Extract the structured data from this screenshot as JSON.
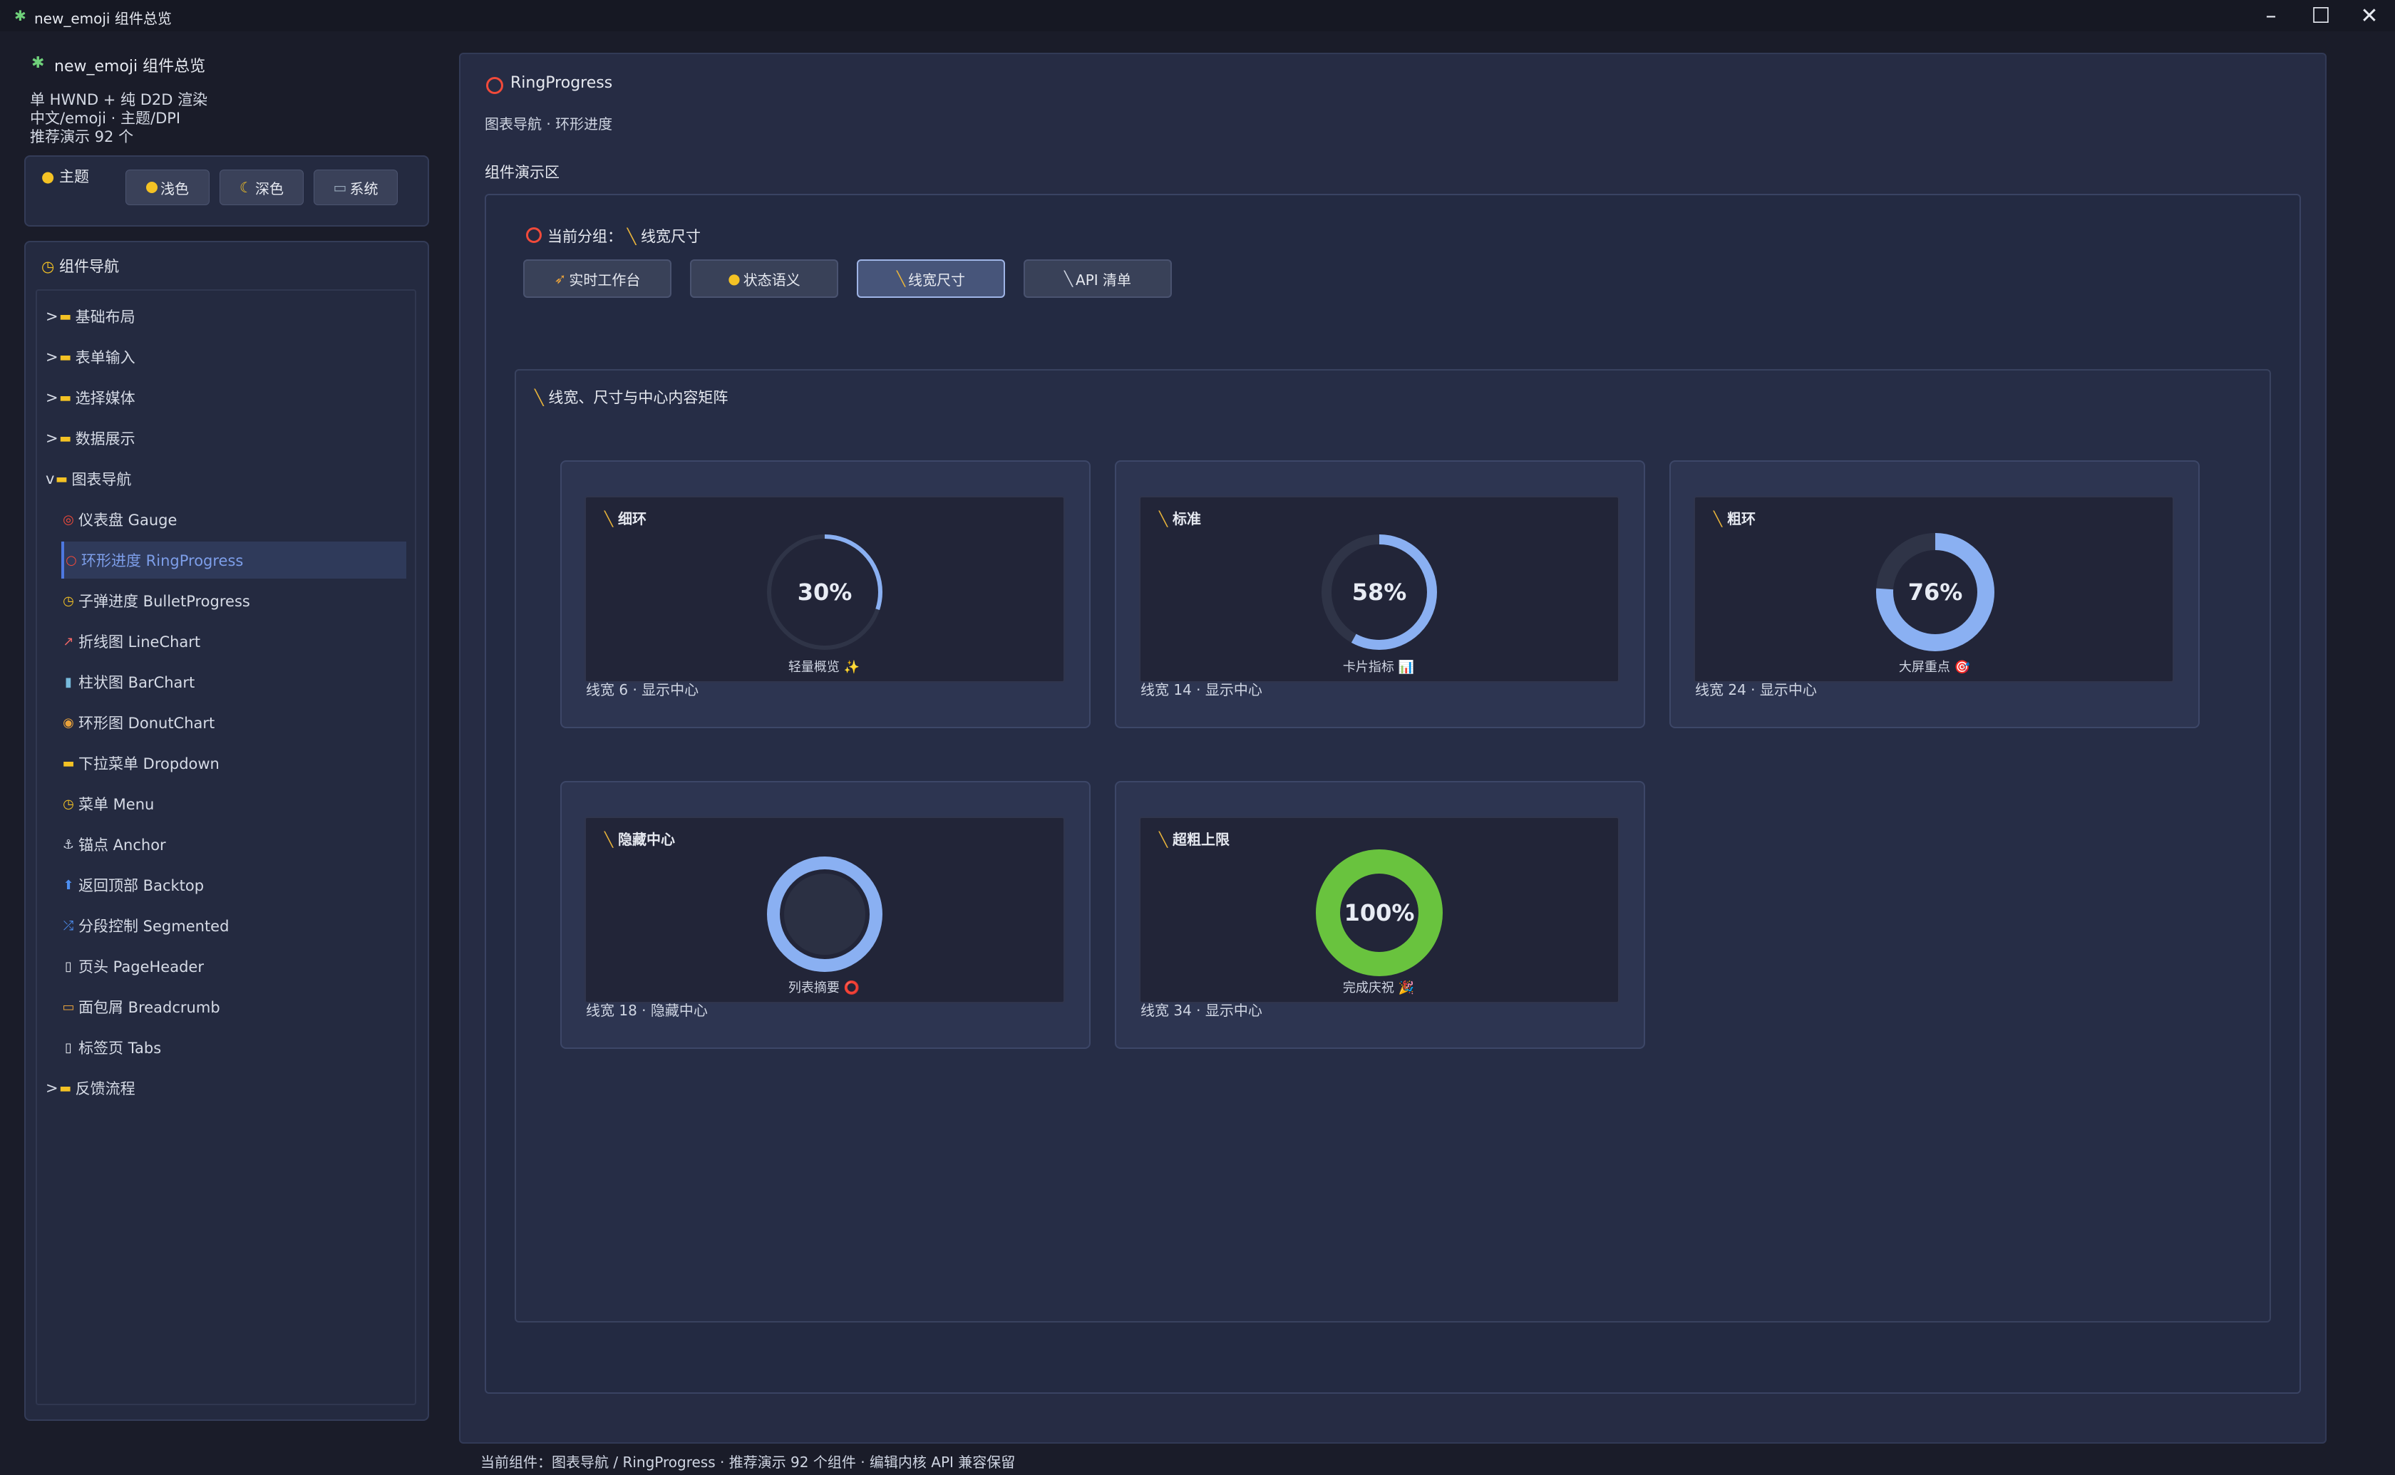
{
  "window": {
    "title": "new_emoji 组件总览",
    "controls": [
      "minimize",
      "maximize",
      "close"
    ]
  },
  "sidebar": {
    "title": "new_emoji 组件总览",
    "info": [
      "单 HWND + 纯 D2D 渲染",
      "中文/emoji · 主题/DPI",
      "推荐演示 92 个"
    ],
    "theme": {
      "label": "主题",
      "options": [
        "浅色",
        "深色",
        "系统"
      ]
    },
    "nav": {
      "label": "组件导航",
      "items": [
        {
          "prefix": ">",
          "label": "基础布局"
        },
        {
          "prefix": ">",
          "label": "表单输入"
        },
        {
          "prefix": ">",
          "label": "选择媒体"
        },
        {
          "prefix": ">",
          "label": "数据展示"
        },
        {
          "prefix": "v",
          "label": "图表导航"
        },
        {
          "label": "仪表盘 Gauge",
          "icon": "dart-icon"
        },
        {
          "label": "环形进度 RingProgress",
          "icon": "ring-icon",
          "selected": true
        },
        {
          "label": "子弹进度 BulletProgress",
          "icon": "clock-icon"
        },
        {
          "label": "折线图 LineChart",
          "icon": "chart-up-icon"
        },
        {
          "label": "柱状图 BarChart",
          "icon": "bar-chart-icon"
        },
        {
          "label": "环形图 DonutChart",
          "icon": "donut-icon"
        },
        {
          "label": "下拉菜单 Dropdown",
          "icon": "folder-icon"
        },
        {
          "label": "菜单 Menu",
          "icon": "clock-icon"
        },
        {
          "label": "锚点 Anchor",
          "icon": "anchor-icon"
        },
        {
          "label": "返回顶部 Backtop",
          "icon": "up-arrow-icon"
        },
        {
          "label": "分段控制 Segmented",
          "icon": "shuffle-icon"
        },
        {
          "label": "页头 PageHeader",
          "icon": "page-icon"
        },
        {
          "label": "面包屑 Breadcrumb",
          "icon": "bread-icon"
        },
        {
          "label": "标签页 Tabs",
          "icon": "page-icon"
        },
        {
          "prefix": ">",
          "label": "反馈流程"
        }
      ]
    }
  },
  "main": {
    "title": "RingProgress",
    "subtitle": "图表导航 · 环形进度",
    "demo_label": "组件演示区",
    "group": {
      "prefix": "当前分组：",
      "value": "线宽尺寸"
    },
    "tabs": [
      "实时工作台",
      "状态语义",
      "线宽尺寸",
      "API 清单"
    ],
    "active_tab": 2,
    "matrix": {
      "title": "线宽、尺寸与中心内容矩阵",
      "cards": [
        {
          "title": "细环",
          "percent": 30,
          "center": "30%",
          "label": "轻量概览 ✨",
          "caption": "线宽 6 · 显示中心",
          "color": "#8ab0f2",
          "stroke": 6
        },
        {
          "title": "标准",
          "percent": 58,
          "center": "58%",
          "label": "卡片指标 📊",
          "caption": "线宽 14 · 显示中心",
          "color": "#8ab0f2",
          "stroke": 14
        },
        {
          "title": "粗环",
          "percent": 76,
          "center": "76%",
          "label": "大屏重点 🎯",
          "caption": "线宽 24 · 显示中心",
          "color": "#8ab0f2",
          "stroke": 24
        },
        {
          "title": "隐藏中心",
          "percent": 100,
          "center": "",
          "label": "列表摘要 ⭕",
          "caption": "线宽 18 · 隐藏中心",
          "color": "#8ab0f2",
          "stroke": 18
        },
        {
          "title": "超粗上限",
          "percent": 100,
          "center": "100%",
          "label": "完成庆祝 🎉",
          "caption": "线宽 34 · 显示中心",
          "color": "#69c33e",
          "stroke": 34
        }
      ]
    }
  },
  "status_bar": "当前组件：图表导航 / RingProgress · 推荐演示 92 个组件 · 编辑内核 API 兼容保留"
}
